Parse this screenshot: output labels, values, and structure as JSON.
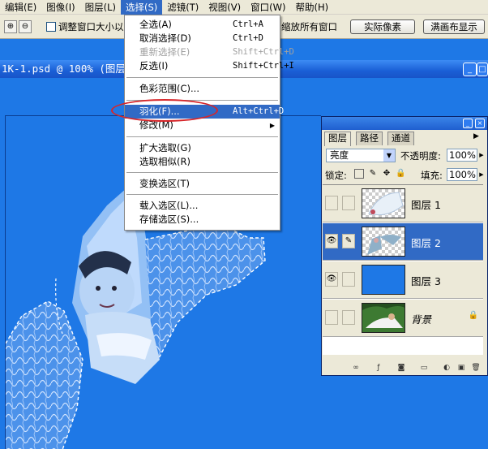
{
  "menubar": {
    "items": [
      {
        "label": "编辑(E)"
      },
      {
        "label": "图像(I)"
      },
      {
        "label": "图层(L)"
      },
      {
        "label": "选择(S)"
      },
      {
        "label": "滤镜(T)"
      },
      {
        "label": "视图(V)"
      },
      {
        "label": "窗口(W)"
      },
      {
        "label": "帮助(H)"
      }
    ]
  },
  "options": {
    "resize_label": "调整窗口大小以",
    "zoom_all_label": "缩放所有窗口",
    "actual_pixels_label": "实际像素",
    "fit_screen_label": "满画布显示"
  },
  "document": {
    "title": "1K-1.psd @ 100% (图层"
  },
  "select_menu": {
    "items": [
      {
        "label": "全选(A)",
        "shortcut": "Ctrl+A"
      },
      {
        "label": "取消选择(D)",
        "shortcut": "Ctrl+D"
      },
      {
        "label": "重新选择(E)",
        "shortcut": "Shift+Ctrl+D"
      },
      {
        "label": "反选(I)",
        "shortcut": "Shift+Ctrl+I"
      },
      {
        "label": "色彩范围(C)..."
      },
      {
        "label": "羽化(F)...",
        "shortcut": "Alt+Ctrl+D"
      },
      {
        "label": "修改(M)"
      },
      {
        "label": "扩大选取(G)"
      },
      {
        "label": "选取相似(R)"
      },
      {
        "label": "变换选区(T)"
      },
      {
        "label": "载入选区(L)..."
      },
      {
        "label": "存储选区(S)..."
      }
    ]
  },
  "layers_panel": {
    "tabs": [
      {
        "label": "图层"
      },
      {
        "label": "路径"
      },
      {
        "label": "通道"
      }
    ],
    "blend_mode": "亮度",
    "opacity_label": "不透明度:",
    "opacity_value": "100%",
    "lock_label": "锁定:",
    "fill_label": "填充:",
    "fill_value": "100%",
    "layers": [
      {
        "name": "图层 1"
      },
      {
        "name": "图层 2"
      },
      {
        "name": "图层 3"
      },
      {
        "name": "背景"
      }
    ]
  },
  "colors": {
    "canvas_blue": "#1e78e6",
    "menu_highlight": "#316ac5",
    "annotation_red": "#d6262a"
  }
}
